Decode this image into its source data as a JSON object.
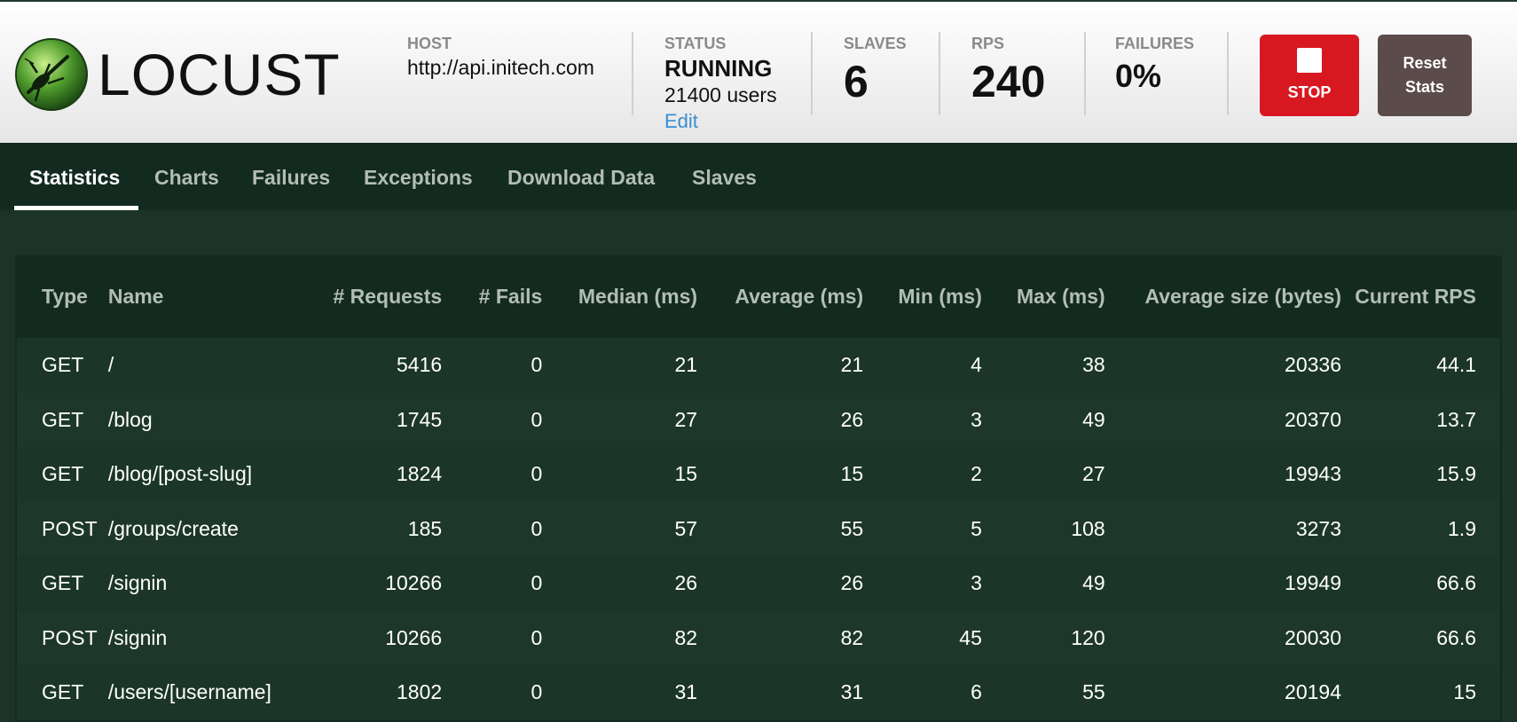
{
  "app": {
    "logo_text": "LOCUST"
  },
  "header": {
    "host": {
      "label": "HOST",
      "value": "http://api.initech.com"
    },
    "status": {
      "label": "STATUS",
      "value": "RUNNING",
      "users": "21400 users",
      "edit": "Edit"
    },
    "slaves": {
      "label": "SLAVES",
      "value": "6"
    },
    "rps": {
      "label": "RPS",
      "value": "240"
    },
    "failures": {
      "label": "FAILURES",
      "value": "0%"
    },
    "stop_label": "STOP",
    "reset_label": "Reset Stats"
  },
  "tabs": [
    {
      "label": "Statistics",
      "active": true
    },
    {
      "label": "Charts"
    },
    {
      "label": "Failures"
    },
    {
      "label": "Exceptions"
    },
    {
      "label": "Download Data"
    },
    {
      "label": "Slaves"
    }
  ],
  "table": {
    "columns": [
      "Type",
      "Name",
      "# Requests",
      "# Fails",
      "Median (ms)",
      "Average (ms)",
      "Min (ms)",
      "Max (ms)",
      "Average size (bytes)",
      "Current RPS"
    ],
    "rows": [
      [
        "GET",
        "/",
        "5416",
        "0",
        "21",
        "21",
        "4",
        "38",
        "20336",
        "44.1"
      ],
      [
        "GET",
        "/blog",
        "1745",
        "0",
        "27",
        "26",
        "3",
        "49",
        "20370",
        "13.7"
      ],
      [
        "GET",
        "/blog/[post-slug]",
        "1824",
        "0",
        "15",
        "15",
        "2",
        "27",
        "19943",
        "15.9"
      ],
      [
        "POST",
        "/groups/create",
        "185",
        "0",
        "57",
        "55",
        "5",
        "108",
        "3273",
        "1.9"
      ],
      [
        "GET",
        "/signin",
        "10266",
        "0",
        "26",
        "26",
        "3",
        "49",
        "19949",
        "66.6"
      ],
      [
        "POST",
        "/signin",
        "10266",
        "0",
        "82",
        "82",
        "45",
        "120",
        "20030",
        "66.6"
      ],
      [
        "GET",
        "/users/[username]",
        "1802",
        "0",
        "31",
        "31",
        "6",
        "55",
        "20194",
        "15"
      ]
    ]
  },
  "colors": {
    "stop_button": "#d81820",
    "reset_button": "#5c4b4b",
    "nav_bg": "#132a20",
    "edit_link": "#3a8fd1"
  }
}
